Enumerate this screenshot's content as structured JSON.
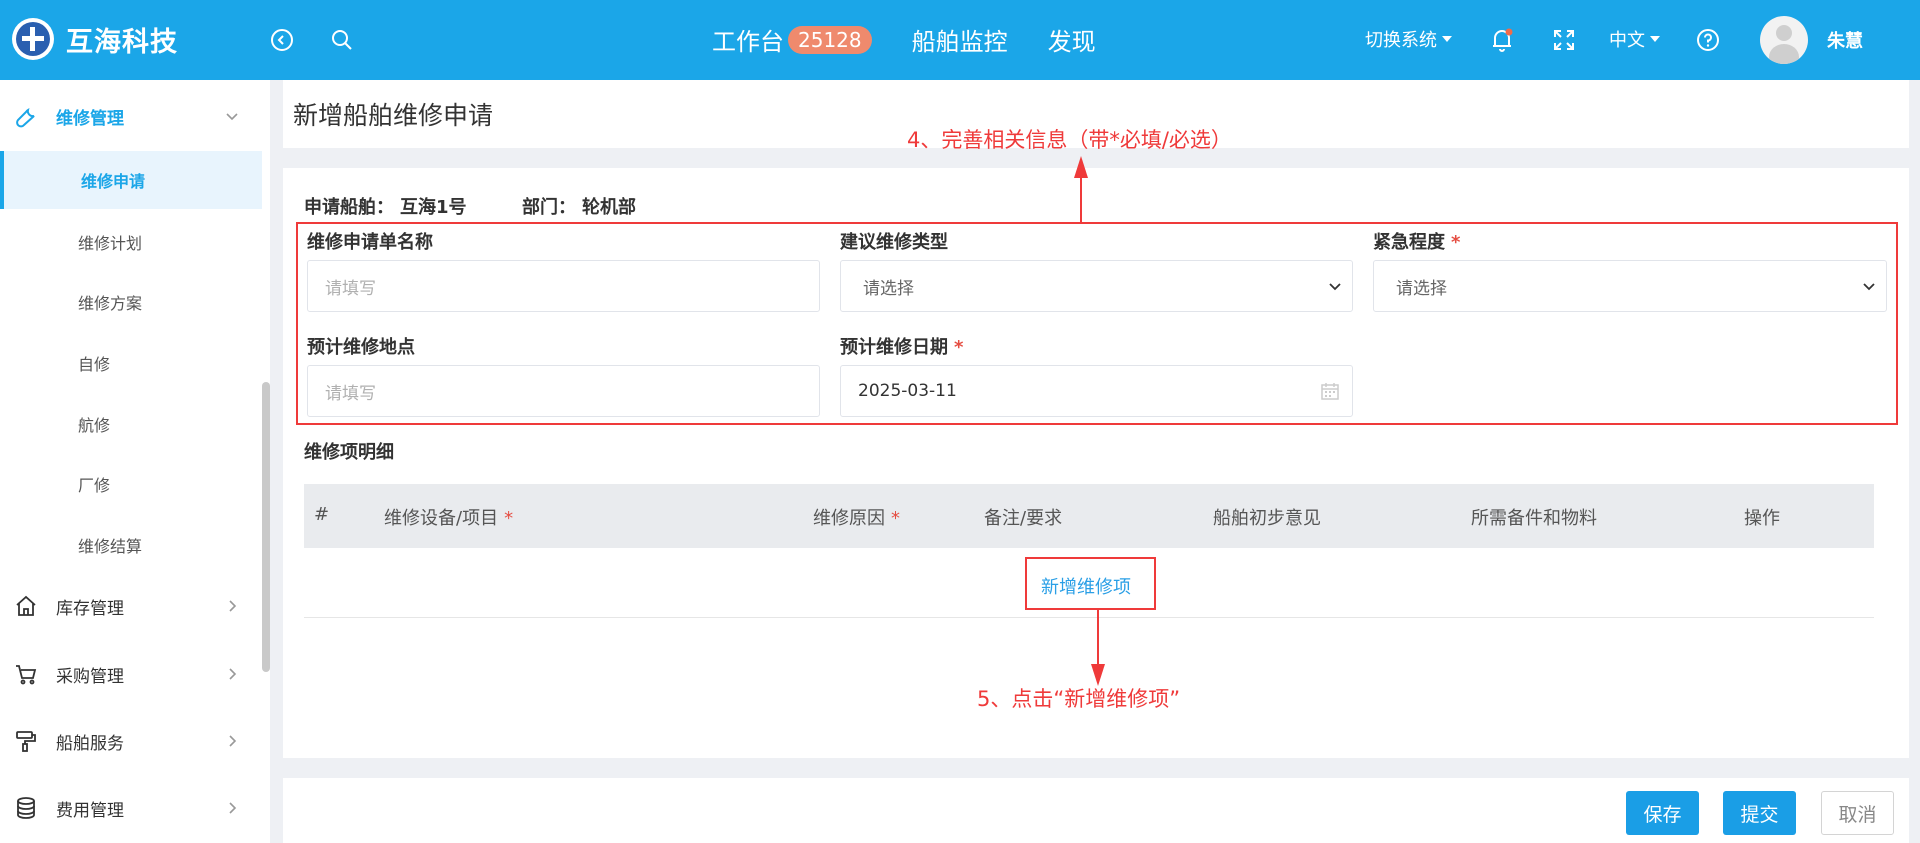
{
  "header": {
    "logo_text": "互海科技",
    "nav": [
      {
        "label": "工作台",
        "badge": "25128"
      },
      {
        "label": "船舶监控"
      },
      {
        "label": "发现"
      }
    ],
    "switch_system": "切换系统",
    "language": "中文",
    "username": "朱慧"
  },
  "sidebar": {
    "groups": [
      {
        "label": "维修管理",
        "icon": "wrench-icon",
        "expanded": true
      },
      {
        "label": "库存管理",
        "icon": "home-icon"
      },
      {
        "label": "采购管理",
        "icon": "cart-icon"
      },
      {
        "label": "船舶服务",
        "icon": "paint-roller-icon"
      },
      {
        "label": "费用管理",
        "icon": "database-icon"
      }
    ],
    "sub_items": [
      "维修申请",
      "维修计划",
      "维修方案",
      "自修",
      "航修",
      "厂修",
      "维修结算"
    ],
    "active_sub": "维修申请"
  },
  "page": {
    "title": "新增船舶维修申请",
    "ship_label": "申请船舶：",
    "ship_value": "互海1号",
    "dept_label": "部门：",
    "dept_value": "轮机部"
  },
  "form": {
    "name": {
      "label": "维修申请单名称",
      "placeholder": "请填写"
    },
    "type": {
      "label": "建议维修类型",
      "placeholder": "请选择"
    },
    "urgency": {
      "label": "紧急程度",
      "required_mark": "*",
      "placeholder": "请选择"
    },
    "location": {
      "label": "预计维修地点",
      "placeholder": "请填写"
    },
    "date": {
      "label": "预计维修日期",
      "required_mark": "*",
      "value": "2025-03-11"
    }
  },
  "items": {
    "section_title": "维修项明细",
    "columns": [
      "#",
      "维修设备/项目",
      "维修原因",
      "备注/要求",
      "船舶初步意见",
      "所需备件和物料",
      "操作"
    ],
    "required_mark": "*",
    "add_link": "新增维修项"
  },
  "annotations": {
    "step4": "4、完善相关信息（带*必填/必选）",
    "step5": "5、点击“新增维修项”"
  },
  "buttons": {
    "save": "保存",
    "submit": "提交",
    "cancel": "取消"
  },
  "colors": {
    "brand": "#1ba6e8",
    "annotation": "#ef3a3a",
    "badge": "#ef8a6d"
  }
}
